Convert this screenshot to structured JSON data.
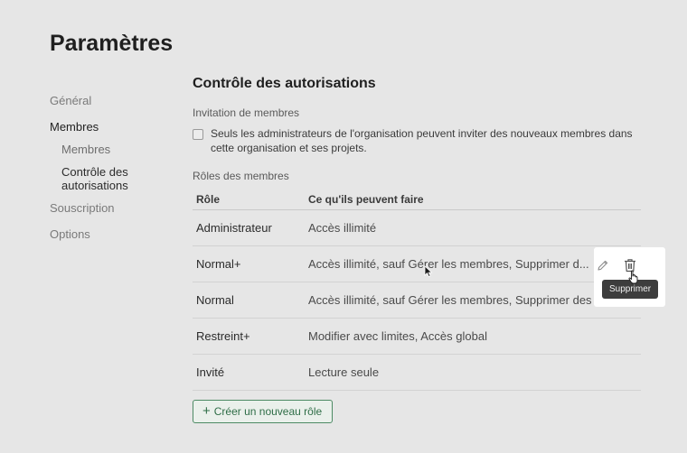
{
  "page": {
    "title": "Paramètres"
  },
  "sidebar": {
    "items": [
      {
        "label": "Général"
      },
      {
        "label": "Membres"
      },
      {
        "label": "Membres"
      },
      {
        "label": "Contrôle des autorisations"
      },
      {
        "label": "Souscription"
      },
      {
        "label": "Options"
      }
    ]
  },
  "section": {
    "title": "Contrôle des autorisations",
    "invite_label": "Invitation de membres",
    "invite_checkbox_text": "Seuls les administrateurs de l'organisation peuvent inviter des nouveaux membres dans cette organisation et ses projets.",
    "roles_label": "Rôles des membres"
  },
  "table": {
    "headers": [
      "Rôle",
      "Ce qu'ils peuvent faire"
    ],
    "rows": [
      {
        "role": "Administrateur",
        "desc": "Accès illimité"
      },
      {
        "role": "Normal+",
        "desc": "Accès illimité, sauf Gérer les membres, Supprimer d..."
      },
      {
        "role": "Normal",
        "desc": "Accès illimité, sauf Gérer les membres, Supprimer des projets..."
      },
      {
        "role": "Restreint+",
        "desc": "Modifier avec limites, Accès global"
      },
      {
        "role": "Invité",
        "desc": "Lecture seule"
      }
    ]
  },
  "actions": {
    "create_role": "Créer un nouveau rôle",
    "delete_tooltip": "Supprimer"
  },
  "icons": {
    "edit": "pencil-icon",
    "delete": "trash-icon",
    "add": "plus-icon"
  },
  "colors": {
    "background": "#e6e6e6",
    "accent": "#2f6e47",
    "tooltip": "#3d3d3d"
  }
}
